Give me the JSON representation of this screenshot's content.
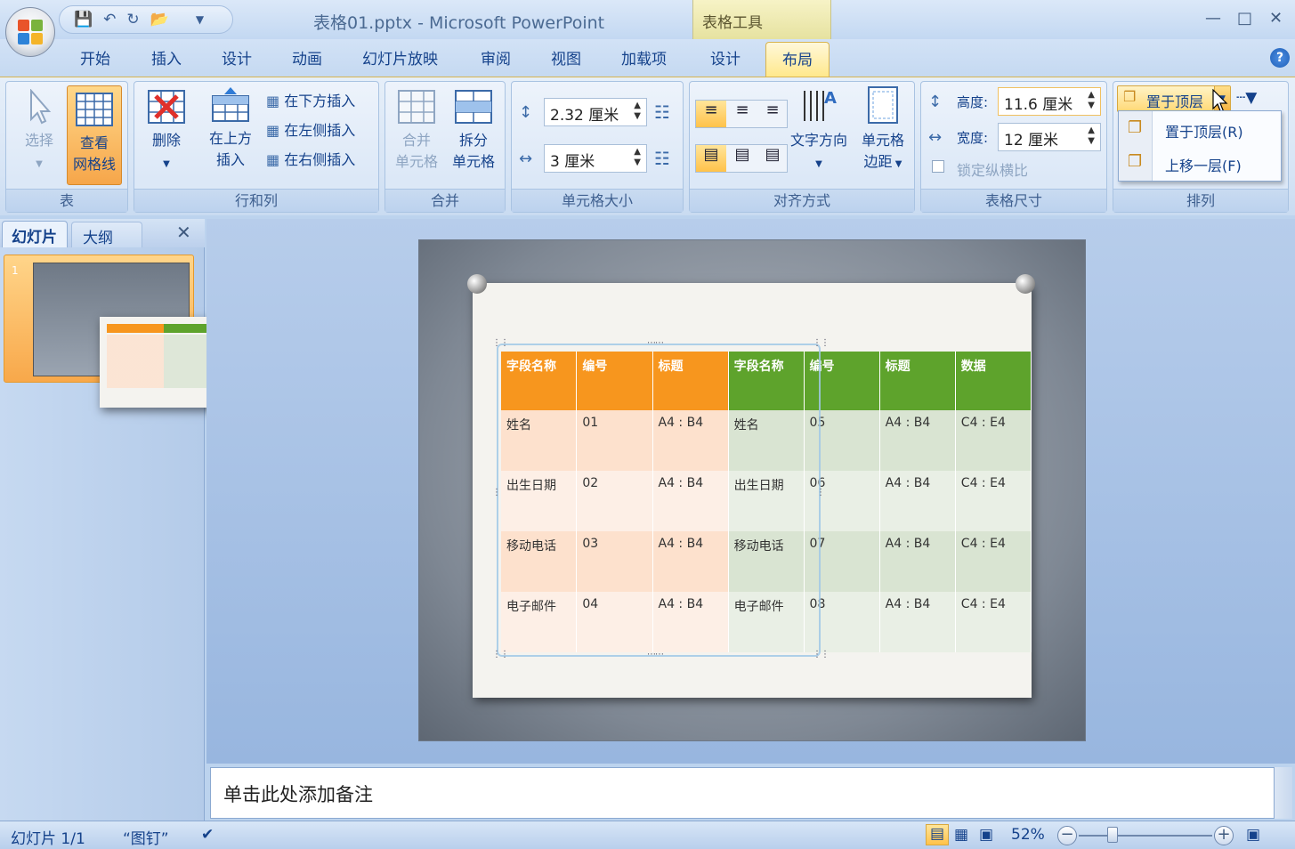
{
  "app": {
    "window_title": "表格01.pptx - Microsoft PowerPoint",
    "context_tool": "表格工具"
  },
  "tabs": [
    "开始",
    "插入",
    "设计",
    "动画",
    "幻灯片放映",
    "审阅",
    "视图",
    "加载项",
    "设计"
  ],
  "active_tab": "布局",
  "ribbon": {
    "table_group": {
      "label": "表",
      "select": "选择",
      "view_gridlines_1": "查看",
      "view_gridlines_2": "网格线"
    },
    "rows_cols_group": {
      "label": "行和列",
      "delete": "删除",
      "insert_above_1": "在上方",
      "insert_above_2": "插入",
      "insert_below": "在下方插入",
      "insert_left": "在左侧插入",
      "insert_right": "在右侧插入"
    },
    "merge_group": {
      "label": "合并",
      "merge_1": "合并",
      "merge_2": "单元格",
      "split_1": "拆分",
      "split_2": "单元格"
    },
    "cell_size_group": {
      "label": "单元格大小",
      "height_value": "2.32 厘米",
      "width_value": "3 厘米"
    },
    "align_group": {
      "label": "对齐方式",
      "text_direction": "文字方向",
      "cell_margin_1": "单元格",
      "cell_margin_2": "边距"
    },
    "table_size_group": {
      "label": "表格尺寸",
      "height_label": "高度:",
      "height_value": "11.6 厘米",
      "width_label": "宽度:",
      "width_value": "12 厘米",
      "lock_ratio": "锁定纵横比"
    },
    "arrange_group": {
      "label": "排列",
      "bring_front": "置于顶层"
    }
  },
  "dropdown": {
    "items": [
      "置于顶层(R)",
      "上移一层(F)"
    ]
  },
  "slides_pane": {
    "tab_slides": "幻灯片",
    "tab_outline": "大纲",
    "slide_number": "1"
  },
  "table": {
    "header": [
      "字段名称",
      "编号",
      "标题",
      "字段名称",
      "编号",
      "标题",
      "数据"
    ],
    "rows": [
      [
        "姓名",
        "01",
        "A4 : B4",
        "姓名",
        "05",
        "A4 : B4",
        "C4 : E4"
      ],
      [
        "出生日期",
        "02",
        "A4 : B4",
        "出生日期",
        "06",
        "A4 : B4",
        "C4 : E4"
      ],
      [
        "移动电话",
        "03",
        "A4 : B4",
        "移动电话",
        "07",
        "A4 : B4",
        "C4 : E4"
      ],
      [
        "电子邮件",
        "04",
        "A4 : B4",
        "电子邮件",
        "08",
        "A4 : B4",
        "C4 : E4"
      ]
    ],
    "colors": {
      "orange_head": "#f7961e",
      "orange_even": "#fde1cd",
      "orange_odd": "#fdefe6",
      "green_head": "#5ea32c",
      "green_even": "#d9e4d2",
      "green_odd": "#e9efe5"
    }
  },
  "notes_placeholder": "单击此处添加备注",
  "status": {
    "slide_info": "幻灯片 1/1",
    "theme": "“图钉”",
    "zoom": "52%"
  },
  "icons": [
    "office-logo",
    "save-icon",
    "undo-icon",
    "redo-icon",
    "open-icon",
    "help-icon",
    "zoom-fit-icon"
  ]
}
